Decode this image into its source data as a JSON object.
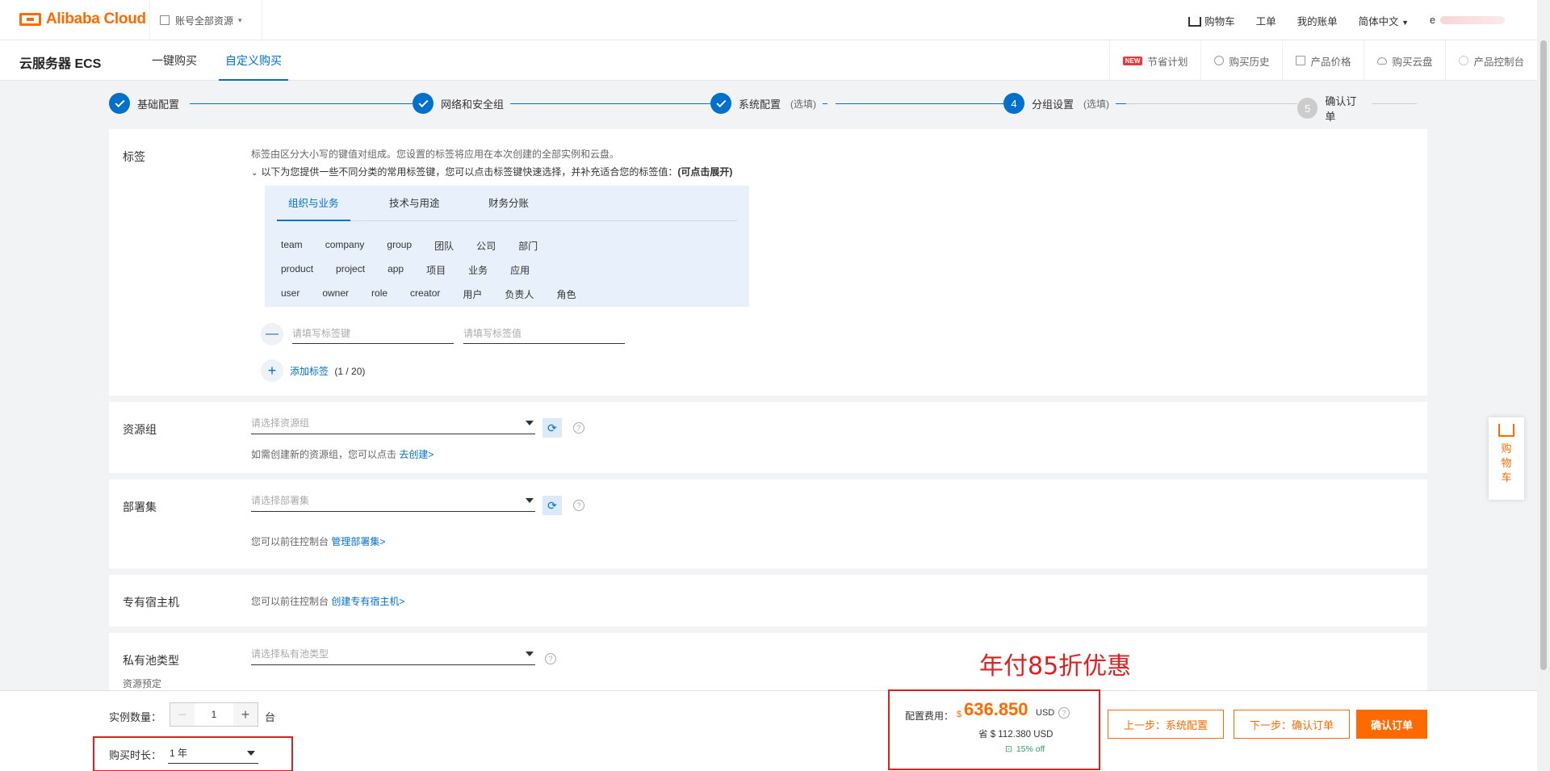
{
  "topbar": {
    "logo": "Alibaba Cloud",
    "resource_scope": "账号全部资源",
    "cart": "购物车",
    "ticket": "工单",
    "bill": "我的账单",
    "language": "简体中文",
    "account_initial": "e"
  },
  "nav": {
    "product_title": "云服务器 ECS",
    "tabs": [
      {
        "label": "一键购买",
        "active": false
      },
      {
        "label": "自定义购买",
        "active": true
      }
    ],
    "right_links": [
      {
        "label": "节省计划",
        "badge": "NEW",
        "icon": "new-badge"
      },
      {
        "label": "购买历史",
        "icon": "clock-icon"
      },
      {
        "label": "产品价格",
        "icon": "document-icon"
      },
      {
        "label": "购买云盘",
        "icon": "cloud-icon"
      },
      {
        "label": "产品控制台",
        "icon": "gear-icon"
      }
    ]
  },
  "steps": [
    {
      "num": "1",
      "label": "基础配置",
      "optional": "",
      "state": "done"
    },
    {
      "num": "2",
      "label": "网络和安全组",
      "optional": "",
      "state": "done"
    },
    {
      "num": "3",
      "label": "系统配置",
      "optional": "(选填)",
      "state": "done"
    },
    {
      "num": "4",
      "label": "分组设置",
      "optional": "(选填)",
      "state": "current"
    },
    {
      "num": "5",
      "label": "确认订单",
      "optional": "",
      "state": "pending"
    }
  ],
  "tags": {
    "label": "标签",
    "desc": "标签由区分大小写的键值对组成。您设置的标签将应用在本次创建的全部实例和云盘。",
    "hint": "以下为您提供一些不同分类的常用标签键，您可以点击标签键快速选择，并补充适合您的标签值：",
    "hint_bold": "(可点击展开)",
    "tabs": [
      {
        "label": "组织与业务",
        "active": true
      },
      {
        "label": "技术与用途",
        "active": false
      },
      {
        "label": "财务分账",
        "active": false
      }
    ],
    "rows": [
      [
        "team",
        "company",
        "group",
        "团队",
        "公司",
        "部门"
      ],
      [
        "product",
        "project",
        "app",
        "项目",
        "业务",
        "应用"
      ],
      [
        "user",
        "owner",
        "role",
        "creator",
        "用户",
        "负责人",
        "角色"
      ]
    ],
    "key_placeholder": "请填写标签键",
    "value_placeholder": "请填写标签值",
    "add_label": "添加标签",
    "count": "(1 / 20)"
  },
  "resource_group": {
    "label": "资源组",
    "placeholder": "请选择资源组",
    "desc": "如需创建新的资源组，您可以点击",
    "link": "去创建>"
  },
  "deployment_set": {
    "label": "部署集",
    "placeholder": "请选择部署集",
    "desc": "您可以前往控制台",
    "link": "管理部署集>"
  },
  "dedicated_host": {
    "label": "专有宿主机",
    "desc": "您可以前往控制台",
    "link": "创建专有宿主机>"
  },
  "private_pool": {
    "label": "私有池类型",
    "sublabel": "资源预定",
    "placeholder": "请选择私有池类型"
  },
  "promo_text": "年付85折优惠",
  "cart_float": [
    "购",
    "物",
    "车"
  ],
  "footer": {
    "qty_label": "实例数量：",
    "qty_value": "1",
    "qty_unit": "台",
    "duration_label": "购买时长：",
    "duration_value": "1 年",
    "cost_label": "配置费用：",
    "cost_currency": "$",
    "cost_value": "636.850",
    "cost_unit": "USD",
    "save_text": "省 $ 112.380 USD",
    "discount": "15% off",
    "prev_button": "上一步：系统配置",
    "next_button": "下一步：确认订单",
    "confirm_button": "确认订单"
  }
}
